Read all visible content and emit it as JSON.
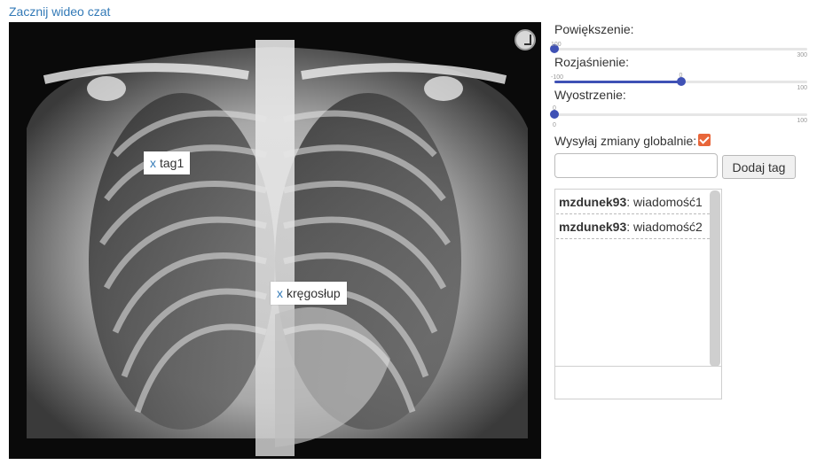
{
  "header": {
    "video_chat_link": "Zacznij wideo czat"
  },
  "viewer": {
    "rotate_icon": "rotate-icon",
    "tags": [
      {
        "remove_label": "x",
        "label": "tag1"
      },
      {
        "remove_label": "x",
        "label": "kręgosłup"
      }
    ]
  },
  "controls": {
    "zoom": {
      "label": "Powiększenie:",
      "min": "100",
      "max": "300",
      "value": 100,
      "fraction": 0.0
    },
    "brightness": {
      "label": "Rozjaśnienie:",
      "min": "-100",
      "max": "100",
      "value_label": "0",
      "value": 0,
      "fraction": 0.5
    },
    "sharpen": {
      "label": "Wyostrzenie:",
      "min": "0",
      "max": "100",
      "value_label": "0",
      "value": 0,
      "fraction": 0.0
    },
    "global_changes": {
      "label": "Wysyłaj zmiany globalnie:",
      "checked": true
    },
    "tag_input": {
      "value": "",
      "placeholder": ""
    },
    "add_tag_label": "Dodaj tag"
  },
  "chat": {
    "messages": [
      {
        "user": "mzdunek93",
        "text": ": wiadomość1"
      },
      {
        "user": "mzdunek93",
        "text": ": wiadomość2"
      }
    ]
  },
  "colors": {
    "link": "#337ab7",
    "slider": "#3f51b5",
    "checkbox": "#e8663a"
  }
}
